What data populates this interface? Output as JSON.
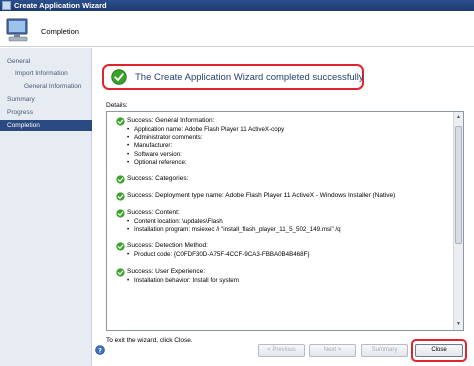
{
  "window": {
    "title": "Create Application Wizard"
  },
  "header": {
    "page_title": "Completion"
  },
  "sidebar": {
    "items": [
      {
        "label": "General",
        "level": 1,
        "active": false
      },
      {
        "label": "Import Information",
        "level": 2,
        "active": false
      },
      {
        "label": "General Information",
        "level": 3,
        "active": false
      },
      {
        "label": "Summary",
        "level": 1,
        "active": false
      },
      {
        "label": "Progress",
        "level": 1,
        "active": false
      },
      {
        "label": "Completion",
        "level": 1,
        "active": true
      }
    ]
  },
  "banner": {
    "message": "The Create Application Wizard completed successfully"
  },
  "details": {
    "label": "Details:",
    "sections": [
      {
        "title": "Success: General Information:",
        "lines": [
          "Application name: Adobe Flash Player 11 ActiveX-copy",
          "Administrator comments:",
          "Manufacturer:",
          "Software version:",
          "Optional reference:"
        ]
      },
      {
        "title": "Success: Categories:",
        "lines": []
      },
      {
        "title": "Success: Deployment type name: Adobe Flash Player 11 ActiveX - Windows Installer (Native)",
        "lines": []
      },
      {
        "title": "Success: Content:",
        "lines": [
          "Content location:                   \\updates\\Flash",
          "Installation program: msiexec /i \"install_flash_player_11_5_502_149.msi\" /q"
        ]
      },
      {
        "title": "Success: Detection Method:",
        "lines": [
          "Product code: {C0FDF30D-A75F-4CCF-9CA3-FBBA0B4B468F}"
        ]
      },
      {
        "title": "Success: User Experience:",
        "lines": [
          "Installation behavior: Install for system"
        ]
      }
    ]
  },
  "footer": {
    "exit_text": "To exit the wizard, click Close.",
    "buttons": {
      "previous": "< Previous",
      "next": "Next >",
      "summary": "Summary",
      "close": "Close"
    }
  },
  "colors": {
    "highlight": "#e0242e",
    "nav_active": "#2a4a82",
    "success_green": "#3aa22b"
  },
  "icons": [
    "app-window-icon",
    "computer-icon",
    "success-check-icon",
    "help-icon"
  ]
}
